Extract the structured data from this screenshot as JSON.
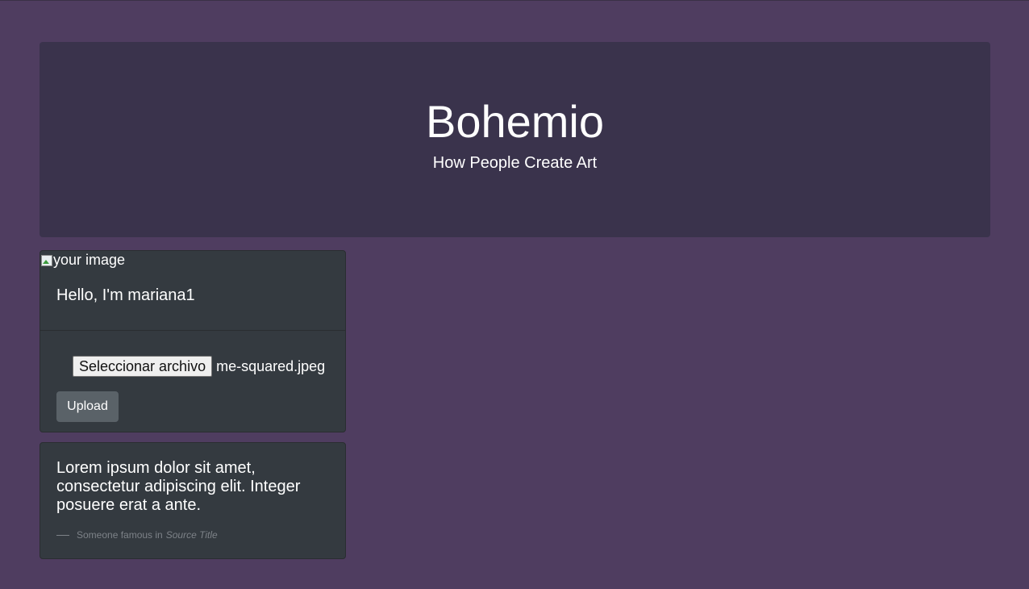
{
  "header": {
    "title": "Bohemio",
    "subtitle": "How People Create Art"
  },
  "profile": {
    "image_alt": "your image",
    "greeting": "Hello, I'm mariana1",
    "file_button_label": "Seleccionar archivo",
    "file_name": "me-squared.jpeg",
    "upload_label": "Upload"
  },
  "quote": {
    "text": "Lorem ipsum dolor sit amet, consectetur adipiscing elit. Integer posuere erat a ante.",
    "author": "Someone famous in",
    "source": "Source Title"
  },
  "colors": {
    "page_background": "#4f3d60",
    "jumbotron_background": "#3a334c",
    "card_background": "#343a40",
    "upload_button": "#5a6268"
  }
}
